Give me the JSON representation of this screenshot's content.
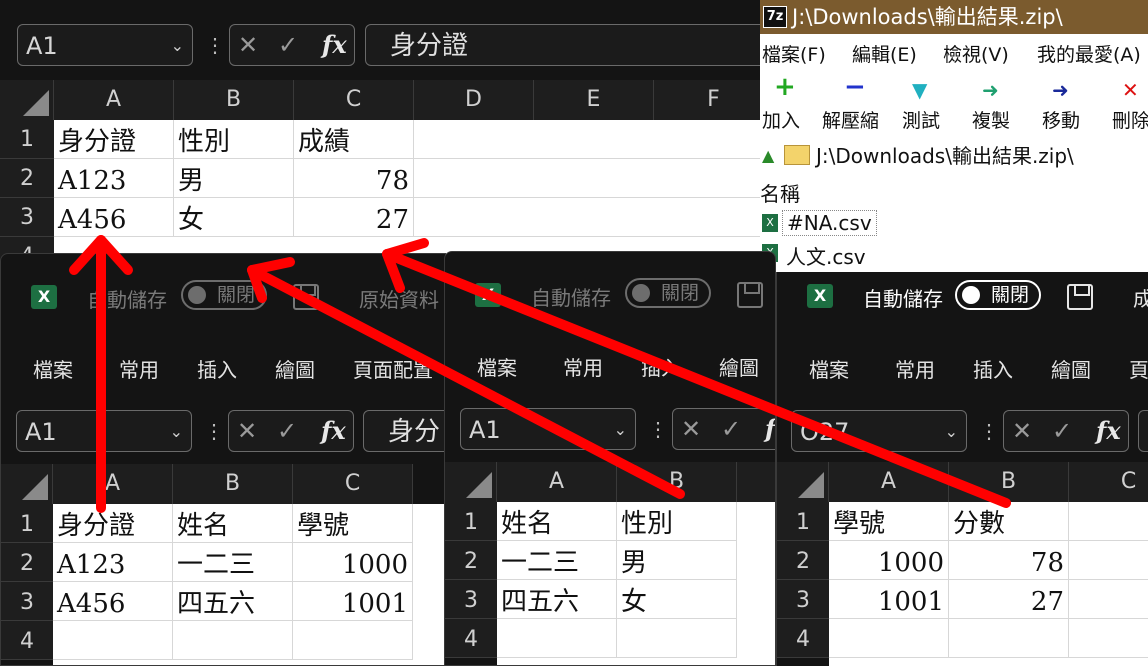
{
  "main": {
    "name_box": "A1",
    "formula": "身分證",
    "fx_label": "fx",
    "columns": [
      "A",
      "B",
      "C",
      "D",
      "E",
      "F"
    ],
    "rows": [
      "1",
      "2",
      "3",
      "4"
    ],
    "cells": [
      [
        "身分證",
        "性別",
        "成績"
      ],
      [
        "A123",
        "男",
        "78"
      ],
      [
        "A456",
        "女",
        "27"
      ]
    ]
  },
  "zip": {
    "title": "J:\\Downloads\\輸出結果.zip\\",
    "logo": "7z",
    "menu": [
      "檔案(F)",
      "編輯(E)",
      "檢視(V)",
      "我的最愛(A)"
    ],
    "toolbar": [
      {
        "label": "加入",
        "icon": "+",
        "color": "#22a822"
      },
      {
        "label": "解壓縮",
        "icon": "−",
        "color": "#2233cc"
      },
      {
        "label": "測試",
        "icon": "▼",
        "color": "#20b0c0"
      },
      {
        "label": "複製",
        "icon": "➜",
        "color": "#20a070"
      },
      {
        "label": "移動",
        "icon": "➜",
        "color": "#1a2a9a"
      },
      {
        "label": "刪除",
        "icon": "✕",
        "color": "#dd1111"
      }
    ],
    "address": "J:\\Downloads\\輸出結果.zip\\",
    "column_header": "名稱",
    "files": [
      "#NA.csv",
      "人文.csv"
    ]
  },
  "win1": {
    "autosave": "自動儲存",
    "toggle": "關閉",
    "filename": "原始資料",
    "tabs": [
      "檔案",
      "常用",
      "插入",
      "繪圖",
      "頁面配置"
    ],
    "name_box": "A1",
    "formula": "身分",
    "fx_label": "fx",
    "columns": [
      "A",
      "B",
      "C"
    ],
    "rows": [
      "1",
      "2",
      "3",
      "4"
    ],
    "cells": [
      [
        "身分證",
        "姓名",
        "學號"
      ],
      [
        "A123",
        "一二三",
        "1000"
      ],
      [
        "A456",
        "四五六",
        "1001"
      ]
    ]
  },
  "win2": {
    "autosave": "自動儲存",
    "toggle": "關閉",
    "tabs": [
      "檔案",
      "常用",
      "插入",
      "繪圖"
    ],
    "name_box": "A1",
    "fx_label": "f",
    "columns": [
      "A",
      "B"
    ],
    "rows": [
      "1",
      "2",
      "3",
      "4"
    ],
    "cells": [
      [
        "姓名",
        "性別"
      ],
      [
        "一二三",
        "男"
      ],
      [
        "四五六",
        "女"
      ]
    ]
  },
  "win3": {
    "autosave": "自動儲存",
    "toggle": "關閉",
    "filename": "成",
    "tabs": [
      "檔案",
      "常用",
      "插入",
      "繪圖",
      "頁"
    ],
    "name_box": "O27",
    "fx_label": "fx",
    "columns": [
      "A",
      "B",
      "C"
    ],
    "rows": [
      "1",
      "2",
      "3",
      "4"
    ],
    "cells": [
      [
        "學號",
        "分數"
      ],
      [
        "1000",
        "78"
      ],
      [
        "1001",
        "27"
      ]
    ]
  },
  "colors": {
    "arrow": "#ff0000",
    "excel_green": "#1d6f42",
    "zip_titlebar": "#7b5b2e"
  }
}
